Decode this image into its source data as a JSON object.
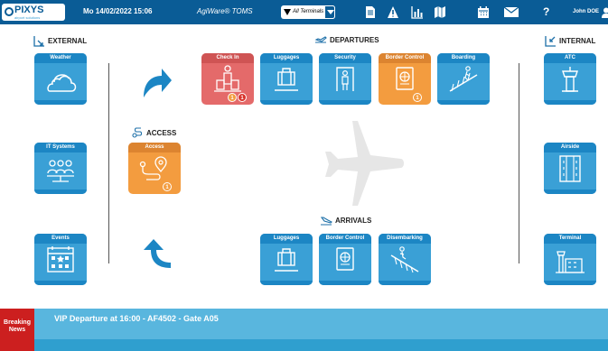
{
  "topbar": {
    "logo": "PIXYS",
    "logo_tag": "airport solutions",
    "datetime": "Mo 14/02/2022 15:06",
    "app_name": "AgiWare® TOMS",
    "terminal_filter": "All Terminals",
    "user": "John DOE",
    "help": "?"
  },
  "sections": {
    "external": "EXTERNAL",
    "departures": "DEPARTURES",
    "internal": "INTERNAL",
    "access": "ACCESS",
    "arrivals": "ARRIVALS"
  },
  "tiles": {
    "weather": "Weather",
    "it_systems": "IT Systems",
    "events": "Events",
    "check_in": "Check In",
    "dep_luggages": "Luggages",
    "security": "Security",
    "dep_border_control": "Border Control",
    "boarding": "Boarding",
    "access": "Access",
    "arr_luggages": "Luggages",
    "arr_border_control": "Border Control",
    "disembarking": "Disembarking",
    "atc": "ATC",
    "airside": "Airside",
    "terminal": "Terminal"
  },
  "badges": {
    "check_in_orange": "1",
    "check_in_red": "1",
    "border_control": "1",
    "access": "1"
  },
  "ticker": {
    "label": "Breaking News",
    "message": "VIP Departure at 16:00 - AF4502 - Gate A05"
  },
  "colors": {
    "topbar": "#0a5c96",
    "tile": "#3aa0d6",
    "tile_alert_red": "#e46a6a",
    "tile_alert_orange": "#f39c3f",
    "ticker": "#59b6de",
    "breaking": "#cc1f1f"
  }
}
